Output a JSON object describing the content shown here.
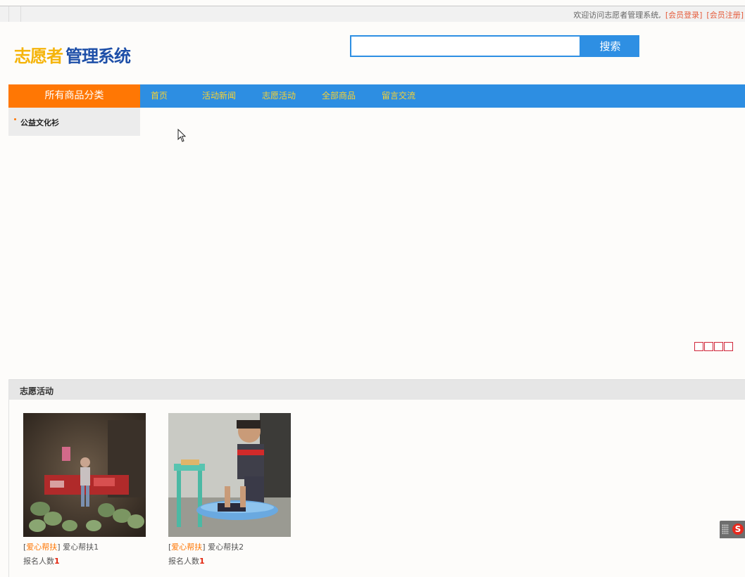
{
  "topbar": {
    "welcome": "欢迎访问志愿者管理系统,",
    "login": "[会员登录]",
    "register": "[会员注册]"
  },
  "logo": {
    "part1": "志愿者",
    "part2": "管理系统"
  },
  "search": {
    "value": "",
    "button": "搜索"
  },
  "nav": {
    "category_header": "所有商品分类",
    "items": [
      "首页",
      "活动新闻",
      "志愿活动",
      "全部商品",
      "留言交流"
    ]
  },
  "categories": [
    "公益文化衫"
  ],
  "section": {
    "title": "志愿活动"
  },
  "activities": [
    {
      "tag": "爱心帮扶",
      "name": "爱心帮扶1",
      "count_label": "报名人数",
      "count": "1"
    },
    {
      "tag": "爱心帮扶",
      "name": "爱心帮扶2",
      "count_label": "报名人数",
      "count": "1"
    }
  ],
  "ime": {
    "letter": "S"
  },
  "colors": {
    "primary": "#2d8ee2",
    "accent": "#ff7704",
    "nav_text": "#f7d233",
    "logo_yellow": "#f5b40a",
    "logo_blue": "#1e4fa8",
    "link_red": "#e55c3c"
  }
}
